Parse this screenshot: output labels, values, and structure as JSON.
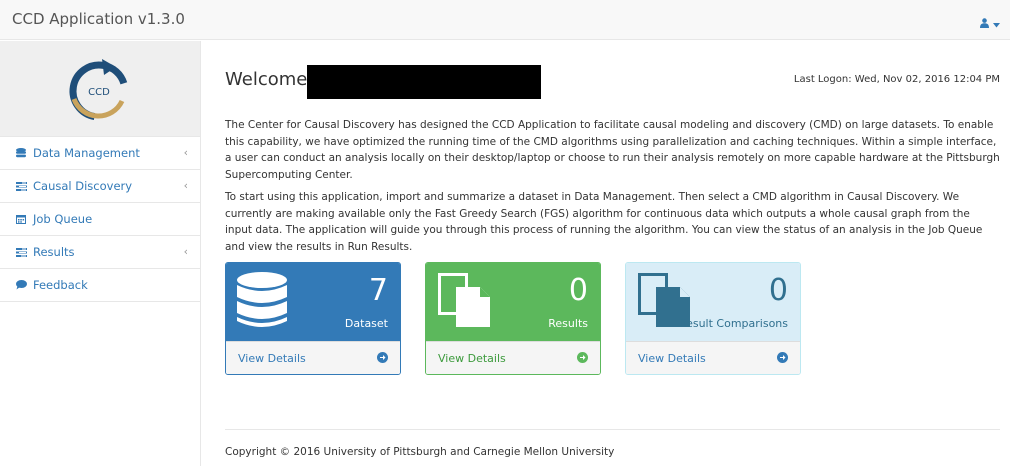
{
  "app": {
    "title": "CCD Application v1.3.0"
  },
  "header": {
    "user_icon": "user-icon",
    "caret_icon": "caret-down-icon"
  },
  "sidebar": {
    "logo_text": "CCD",
    "items": [
      {
        "label": "Data Management",
        "icon": "database-icon",
        "chevron": "‹"
      },
      {
        "label": "Causal Discovery",
        "icon": "tasks-icon",
        "chevron": "‹"
      },
      {
        "label": "Job Queue",
        "icon": "calendar-icon",
        "chevron": ""
      },
      {
        "label": "Results",
        "icon": "tasks-icon",
        "chevron": "‹"
      },
      {
        "label": "Feedback",
        "icon": "comment-icon",
        "chevron": ""
      }
    ]
  },
  "main": {
    "welcome": "Welcome",
    "last_logon": "Last Logon: Wed, Nov 02, 2016 12:04 PM",
    "para1": "The Center for Causal Discovery has designed the CCD Application to facilitate causal modeling and discovery (CMD) on large datasets. To enable this capability, we have optimized the running time of the CMD algorithms using parallelization and caching techniques. Within a simple interface, a user can conduct an analysis locally on their desktop/laptop or choose to run their analysis remotely on more capable hardware at the Pittsburgh Supercomputing Center.",
    "para2": "To start using this application, import and summarize a dataset in Data Management. Then select a CMD algorithm in Causal Discovery. We currently are making available only the Fast Greedy Search (FGS) algorithm for continuous data which outputs a whole causal graph from the input data. The application will guide you through this process of running the algorithm. You can view the status of an analysis in the Job Queue and view the results in Run Results."
  },
  "panels": [
    {
      "count": "7",
      "label": "Dataset",
      "link": "View Details",
      "icon": "database-icon",
      "color": "#337ab7"
    },
    {
      "count": "0",
      "label": "Results",
      "link": "View Details",
      "icon": "files-icon",
      "color": "#5cb85c"
    },
    {
      "count": "0",
      "label": "Result Comparisons",
      "link": "View Details",
      "icon": "files-icon",
      "color": "#d9edf7"
    }
  ],
  "footer": {
    "copyright": "Copyright © 2016 University of Pittsburgh and Carnegie Mellon University"
  }
}
